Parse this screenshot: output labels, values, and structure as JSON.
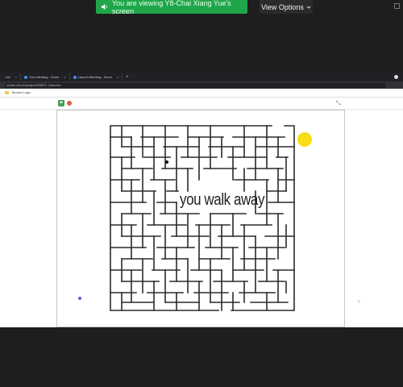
{
  "zoom": {
    "share_banner": "You are viewing Y8-Chai Xiang Yue's screen",
    "view_options": "View Options",
    "view_options_chevron": "chevron-down-icon"
  },
  "browser": {
    "tabs": [
      {
        "label": "...ect",
        "icon": "tab-favicon"
      },
      {
        "label": "Your Meeting - Zoom",
        "icon": "zoom-favicon"
      },
      {
        "label": "Launch Meeting - Zoom",
        "icon": "zoom-favicon"
      }
    ],
    "url": "scratch.mit.edu/projects/598879...fullscreen",
    "bookmark": "Blooket Login"
  },
  "scratch": {
    "caption": "you walk away"
  }
}
